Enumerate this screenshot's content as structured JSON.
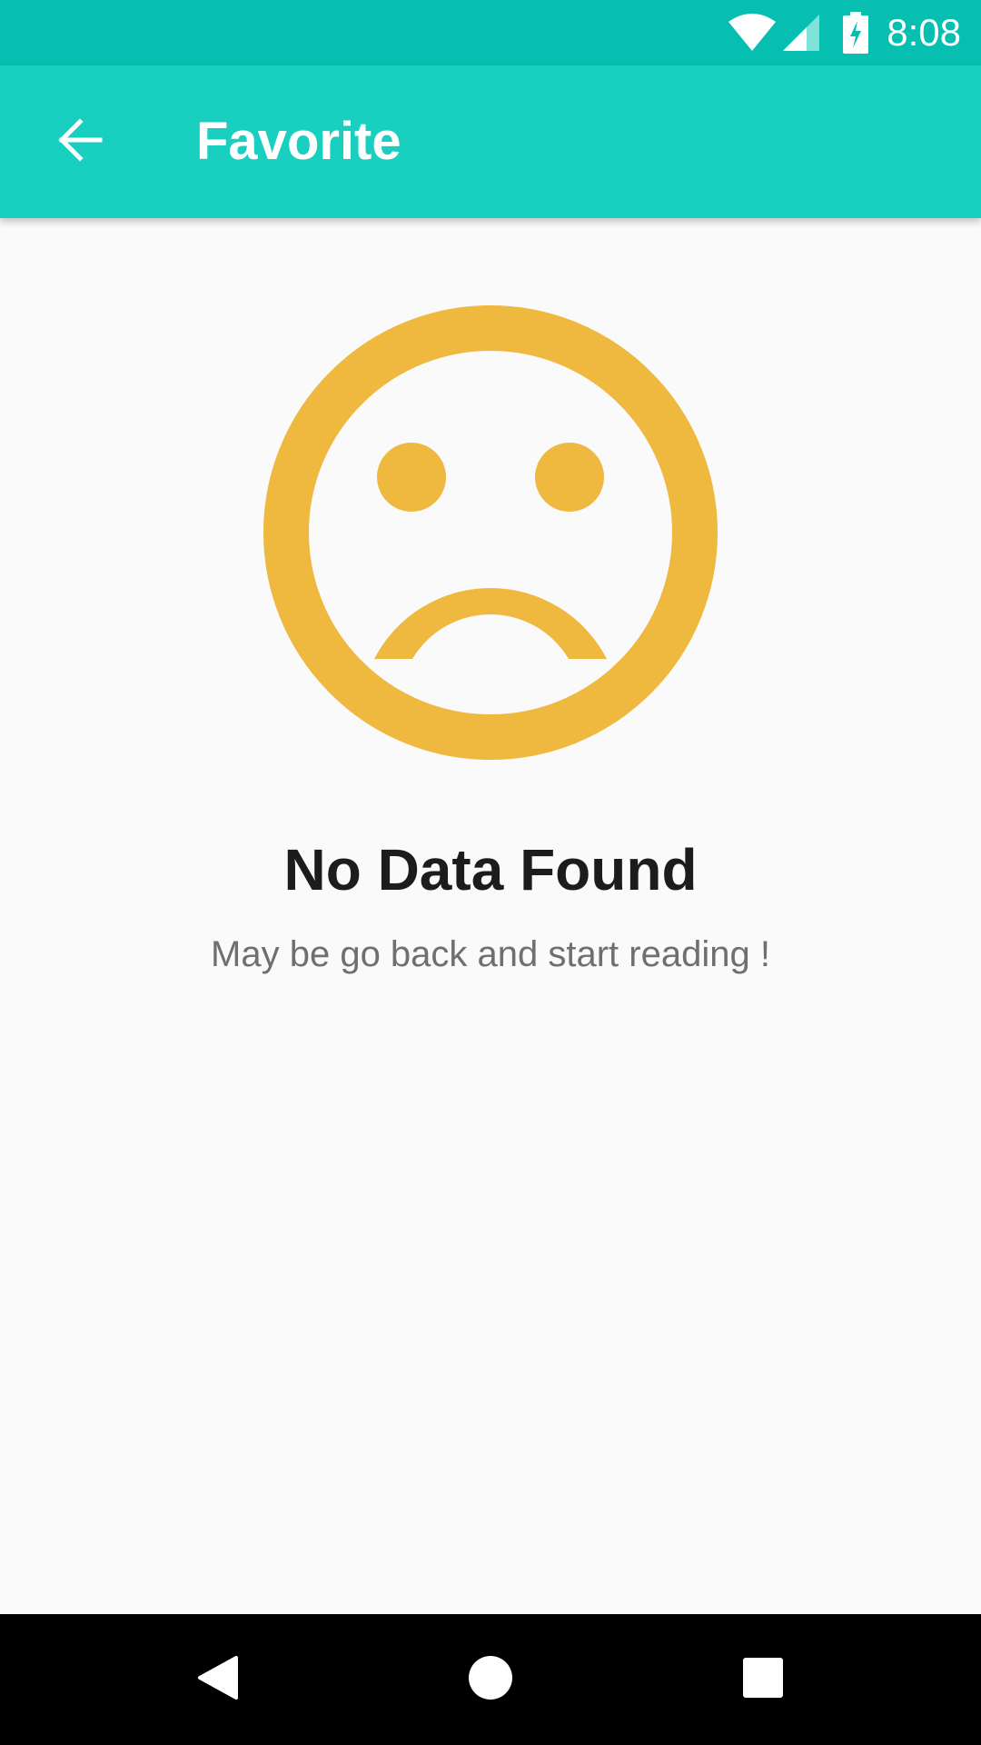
{
  "status_bar": {
    "time": "8:08",
    "icons": [
      "wifi-icon",
      "cell-signal-icon",
      "battery-charging-icon"
    ]
  },
  "app_bar": {
    "title": "Favorite",
    "back_icon": "arrow-back-icon"
  },
  "empty_state": {
    "icon": "sad-face-icon",
    "title": "No Data Found",
    "subtitle": "May be go back and start reading !"
  },
  "nav_bar": {
    "buttons": [
      "nav-back-icon",
      "nav-home-icon",
      "nav-recents-icon"
    ]
  },
  "colors": {
    "status_bar": "#06bfb0",
    "app_bar": "#19d0c0",
    "accent_icon": "#efb940",
    "background": "#fafafa",
    "title_text": "#1c1c1c",
    "subtitle_text": "#6f6f6f"
  }
}
